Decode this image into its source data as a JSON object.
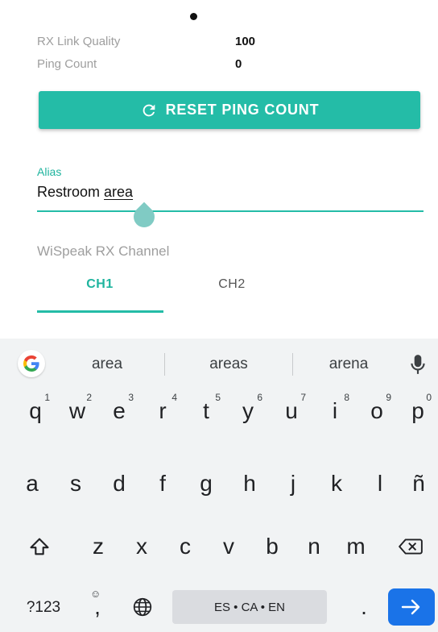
{
  "status": {
    "rx_link_quality_label": "RX Link Quality",
    "rx_link_quality_value": "100",
    "ping_count_label": "Ping Count",
    "ping_count_value": "0"
  },
  "reset_button": {
    "label": "RESET PING COUNT",
    "icon": "refresh-icon"
  },
  "alias": {
    "label": "Alias",
    "value_prefix": "Restroom ",
    "value_current_word": "area"
  },
  "channel": {
    "label": "WiSpeak RX Channel",
    "tabs": [
      {
        "label": "CH1",
        "selected": true
      },
      {
        "label": "CH2",
        "selected": false
      }
    ]
  },
  "keyboard": {
    "suggestions": [
      "area",
      "areas",
      "arena"
    ],
    "row1": [
      {
        "key": "q",
        "hint": "1"
      },
      {
        "key": "w",
        "hint": "2"
      },
      {
        "key": "e",
        "hint": "3"
      },
      {
        "key": "r",
        "hint": "4"
      },
      {
        "key": "t",
        "hint": "5"
      },
      {
        "key": "y",
        "hint": "6"
      },
      {
        "key": "u",
        "hint": "7"
      },
      {
        "key": "i",
        "hint": "8"
      },
      {
        "key": "o",
        "hint": "9"
      },
      {
        "key": "p",
        "hint": "0"
      }
    ],
    "row2": [
      "a",
      "s",
      "d",
      "f",
      "g",
      "h",
      "j",
      "k",
      "l",
      "ñ"
    ],
    "row3": [
      "z",
      "x",
      "c",
      "v",
      "b",
      "n",
      "m"
    ],
    "symbols_label": "?123",
    "comma_label": ",",
    "emoji_hint": "☺",
    "space_label": "ES • CA • EN",
    "period_label": ".",
    "accent_color": "#1a73e8"
  },
  "colors": {
    "primary": "#24bca7",
    "primary_text": "#1fb49e"
  }
}
